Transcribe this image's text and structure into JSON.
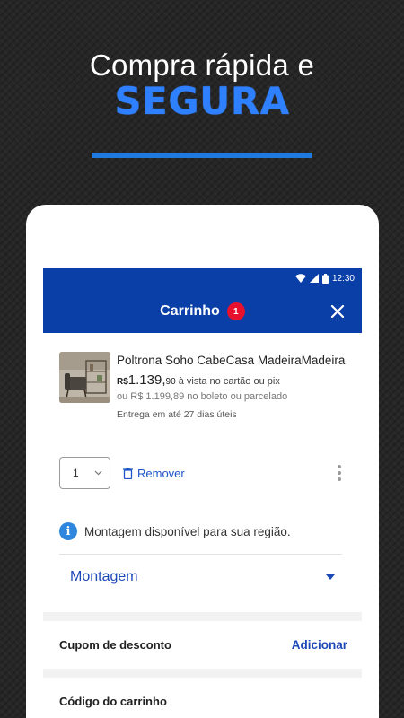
{
  "promo": {
    "headline": "Compra rápida e",
    "highlight": "SEGURA"
  },
  "status_bar": {
    "time": "12:30",
    "icons": [
      "wifi-icon",
      "signal-icon",
      "battery-icon"
    ]
  },
  "appbar": {
    "title": "Carrinho",
    "badge_count": "1",
    "close_icon": "close-icon"
  },
  "cart_item": {
    "name": "Poltrona Soho CabeCasa MadeiraMadeira",
    "price_currency": "R$",
    "price_main": "1.139,",
    "price_cents": "90",
    "price_note": "à vista no cartão ou pix",
    "alt_price": "ou R$ 1.199,89 no boleto ou parcelado",
    "delivery": "Entrega em até 27 dias úteis",
    "quantity": "1",
    "remove_label": "Remover"
  },
  "assembly": {
    "notice": "Montagem disponível para sua região.",
    "dropdown_label": "Montagem"
  },
  "coupon": {
    "label": "Cupom de desconto",
    "action": "Adicionar"
  },
  "cart_code": {
    "label": "Código do carrinho"
  },
  "colors": {
    "appbar": "#0a3fa8",
    "accent_blue": "#1d48b8",
    "highlight": "#2f80ff",
    "badge": "#e8112d",
    "info": "#2e86de"
  }
}
